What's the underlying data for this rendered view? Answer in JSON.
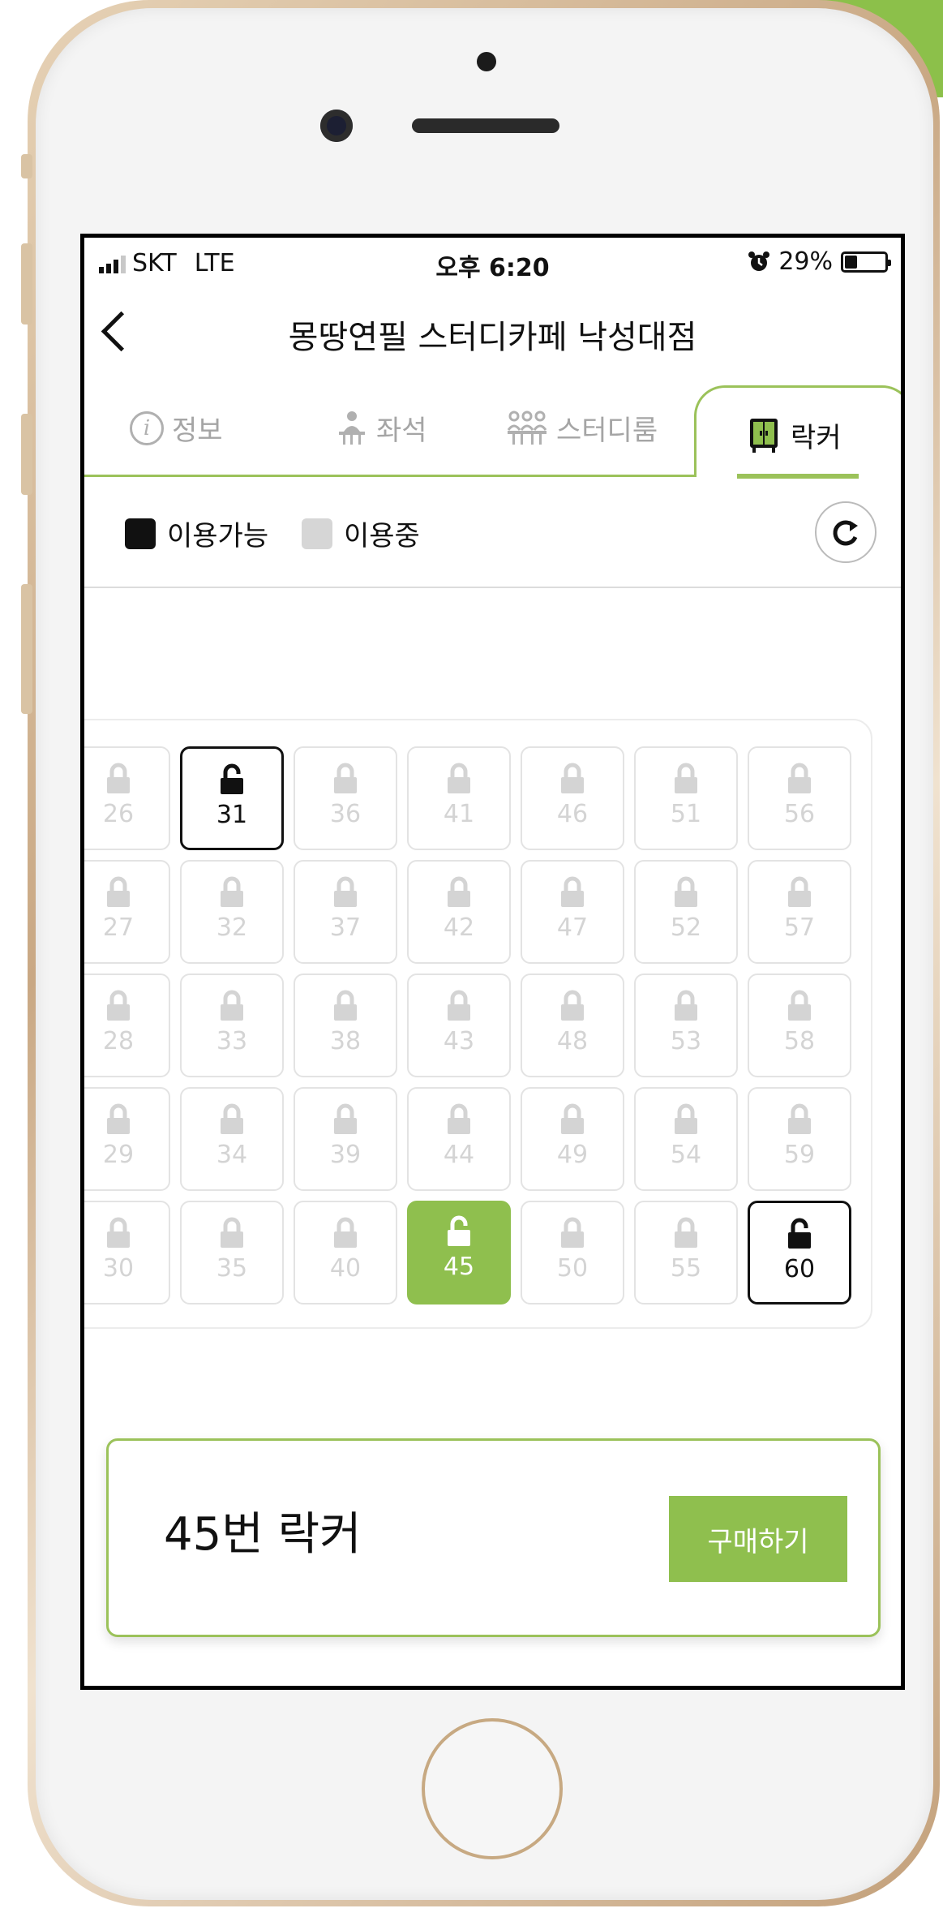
{
  "status_bar": {
    "carrier": "SKT",
    "network": "LTE",
    "time": "오후 6:20",
    "battery": "29%"
  },
  "header": {
    "title": "몽땅연필 스터디카페 낙성대점"
  },
  "tabs": [
    {
      "label": "정보",
      "icon": "info-icon"
    },
    {
      "label": "좌석",
      "icon": "seat-icon"
    },
    {
      "label": "스터디룸",
      "icon": "group-icon"
    },
    {
      "label": "락커",
      "icon": "locker-icon"
    }
  ],
  "legend": {
    "available": "이용가능",
    "in_use": "이용중"
  },
  "lockers": {
    "columns": [
      [
        "26",
        "27",
        "28",
        "29",
        "30"
      ],
      [
        "31",
        "32",
        "33",
        "34",
        "35"
      ],
      [
        "36",
        "37",
        "38",
        "39",
        "40"
      ],
      [
        "41",
        "42",
        "43",
        "44",
        "45"
      ],
      [
        "46",
        "47",
        "48",
        "49",
        "50"
      ],
      [
        "51",
        "52",
        "53",
        "54",
        "55"
      ],
      [
        "56",
        "57",
        "58",
        "59",
        "60"
      ]
    ],
    "available": [
      "31",
      "60"
    ],
    "selected": "45"
  },
  "selection": {
    "title": "45번 락커",
    "buy_label": "구매하기"
  },
  "colors": {
    "accent": "#8fbf4e",
    "available": "#111111",
    "in_use": "#d6d6d6"
  }
}
